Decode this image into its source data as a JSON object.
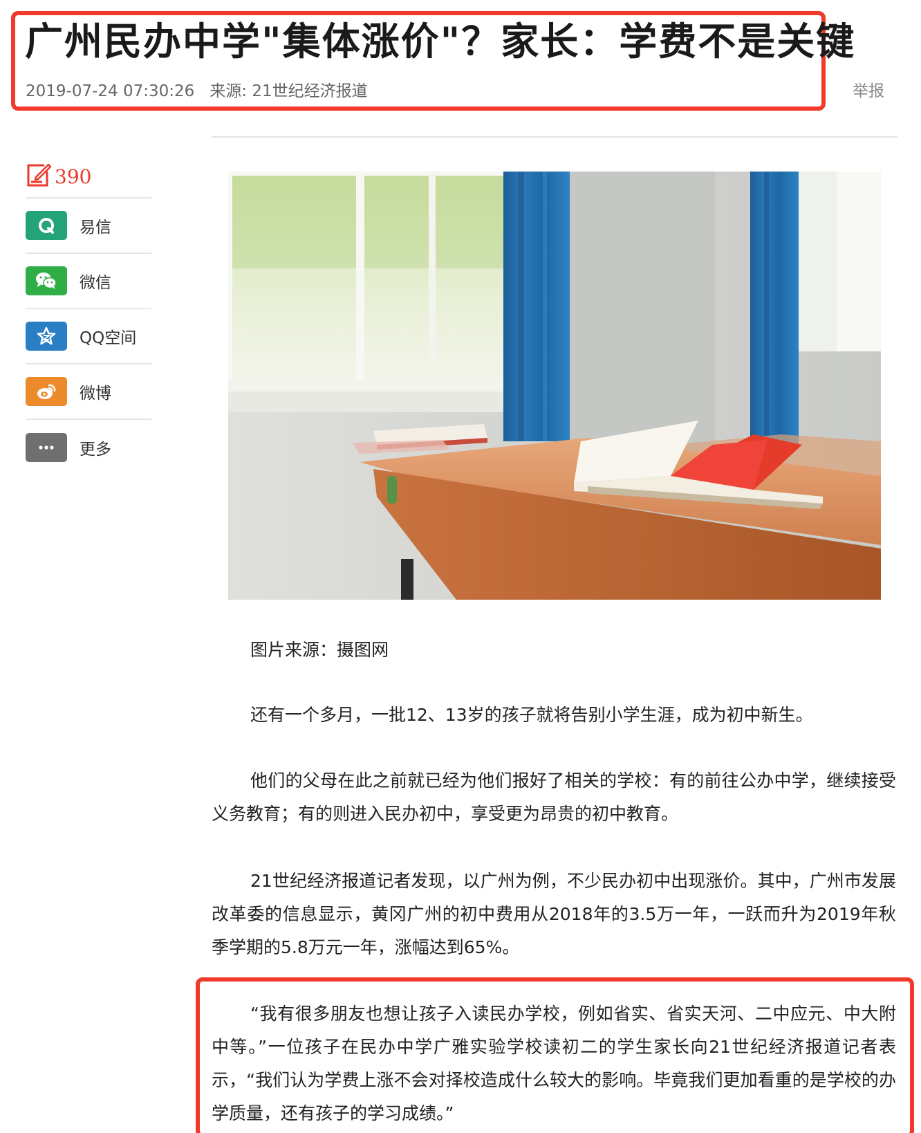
{
  "article": {
    "title": "广州民办中学\"集体涨价\"？家长：学费不是关键",
    "datetime": "2019-07-24 07:30:26",
    "source": "来源: 21世纪经济报道",
    "report_label": "举报"
  },
  "share": {
    "comment_count": "390",
    "items": [
      {
        "label": "易信",
        "icon": "yixin-icon",
        "color": "#24a37a"
      },
      {
        "label": "微信",
        "icon": "wechat-icon",
        "color": "#2fae45"
      },
      {
        "label": "QQ空间",
        "icon": "qzone-star-icon",
        "color": "#2a7fc4"
      },
      {
        "label": "微博",
        "icon": "weibo-icon",
        "color": "#ec8a2c"
      },
      {
        "label": "更多",
        "icon": "more-dots-icon",
        "color": "#6f6f6f"
      }
    ]
  },
  "body": {
    "caption": "图片来源：摄图网",
    "paragraphs": [
      "还有一个多月，一批12、13岁的孩子就将告别小学生涯，成为初中新生。",
      "他们的父母在此之前就已经为他们报好了相关的学校：有的前往公办中学，继续接受义务教育；有的则进入民办初中，享受更为昂贵的初中教育。",
      "21世纪经济报道记者发现，以广州为例，不少民办初中出现涨价。其中，广州市发展改革委的信息显示，黄冈广州的初中费用从2018年的3.5万一年，一跃而升为2019年秋季学期的5.8万元一年，涨幅达到65%。",
      "“我有很多朋友也想让孩子入读民办学校，例如省实、省实天河、二中应元、中大附中等。”一位孩子在民办中学广雅实验学校读初二的学生家长向21世纪经济报道记者表示，“我们认为学费上涨不会对择校造成什么较大的影响。毕竟我们更加看重的是学校的办学质量，还有孩子的学习成绩。”"
    ]
  },
  "colors": {
    "highlight_border": "#f23a2a",
    "comment_red": "#e83a2a"
  }
}
